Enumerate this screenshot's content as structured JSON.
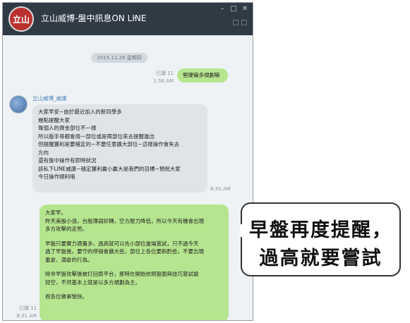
{
  "window": {
    "title": "立山威博-盤中訊息ON LINE",
    "avatar_text": "立山"
  },
  "chat": {
    "date_divider": "2015.11.26 星期四",
    "messages": [
      {
        "direction": "out",
        "read": "已讀 11",
        "time": "1:56 AM",
        "lines": [
          "堅硬偏多規劃嘛"
        ]
      },
      {
        "direction": "in",
        "sender": "立山威博_威康",
        "time": "8:30 AM",
        "lines": [
          "大家早安~由於最近加入的新同學多",
          "幾點提醒大家",
          "每個人的資金部位不一樣",
          "所以版手哥都會用一部位或是兩部位來去提醒進出",
          "但提醒獲利是要穩定的~不要任意擴大部位~這樣操作會失去",
          "方向",
          "還有盤中操作有即時狀況",
          "該私下LINE威康~穩定獲利贏小贏大是我們的目標~預祝大家",
          "今日操作順利唷"
        ]
      },
      {
        "direction": "out",
        "read": "已讀 11",
        "time": "8:31 AM",
        "paragraphs": [
          [
            "大家早。"
          ],
          [
            "昨天美股小漲，台股簿弱好轉，空方壓力降低，所以今天有機會出現",
            "多方攻擊的走勢。"
          ],
          [
            "早盤只要實力適量多，過高就可以先小部位進場嘗試，只不過今天",
            "過了早盤後，要守的停損會擴大些，部位上各位要斟酌些，不要出現",
            "重倉、滿倉的行為。"
          ],
          [
            "除非早盤攻擊後被打回原平台，那時在開始依照盤面與技巧嘗試搶",
            "短空，不然基本上就是以多方規劃為主。"
          ],
          [
            "祝各位做單愉快。"
          ]
        ]
      }
    ]
  },
  "callout": {
    "line1": "早盤再度提醒，",
    "line2": "過高就要嘗試"
  },
  "colors": {
    "titlebar": "#2f3a45",
    "sent_bubble": "#b5e68f",
    "received_bubble": "#dfe4e8",
    "chat_background": "#eef2f5"
  }
}
